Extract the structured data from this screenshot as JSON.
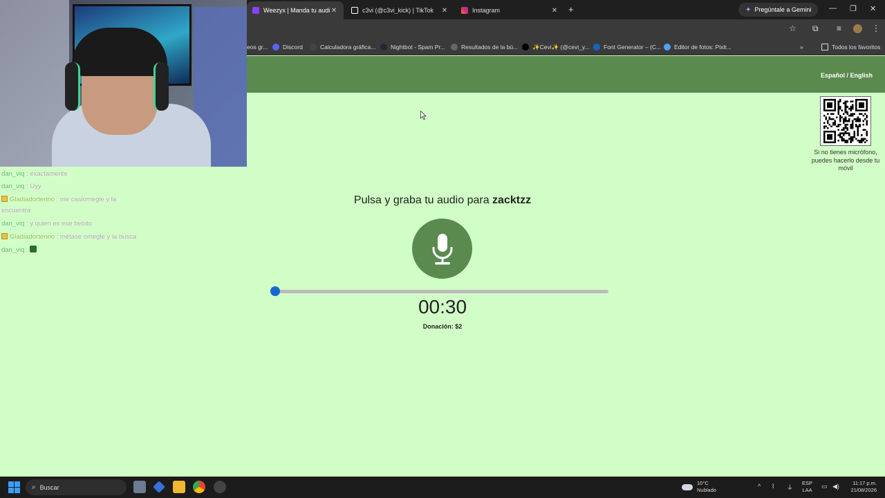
{
  "browser": {
    "tabs": [
      {
        "label": "Weezyx | Manda tu audio a zac",
        "active": true,
        "favicon_color": "#8a3ffc"
      },
      {
        "label": "c3vi (@c3vi_kick) | TikTok",
        "active": false,
        "favicon_color": "#ffffff"
      },
      {
        "label": "Instagram",
        "active": false,
        "favicon_color": "#e1306c"
      }
    ],
    "new_tab": "+",
    "gemini_button": "Pregúntale a Gemini",
    "window_controls": {
      "minimize": "—",
      "maximize": "❐",
      "close": "✕"
    },
    "bookmarks": [
      {
        "label": "eos gr...",
        "icon_color": "#555"
      },
      {
        "label": "Discord",
        "icon_color": "#5865f2"
      },
      {
        "label": "Calculadora gráfica...",
        "icon_color": "#444"
      },
      {
        "label": "Nightbot - Spam Pr...",
        "icon_color": "#1e2a38"
      },
      {
        "label": "Resultados de la bú...",
        "icon_color": "#666"
      },
      {
        "label": "✨Cevi✨ (@cevi_y...",
        "icon_color": "#000"
      },
      {
        "label": "Font Generator – (C...",
        "icon_color": "#1565c0"
      },
      {
        "label": "Editor de fotos: Pixlr...",
        "icon_color": "#4fa3ff"
      }
    ],
    "bookmarks_overflow": "»",
    "all_bookmarks": "Todos los favoritos"
  },
  "page": {
    "header_color": "#5a8a4e",
    "background_color": "#d1fec6",
    "language_toggle": "Español / English",
    "qr_caption": "Si no tienes micrófono, puedes hacerlo desde tu móvil",
    "prompt_text": "Pulsa y graba tu audio para ",
    "recipient": "zacktzz",
    "timer": "00:30",
    "donation": "Donación: $2",
    "progress_fraction": 0.0,
    "accent_color": "#1a66d2"
  },
  "stream_overlay": {
    "chat": [
      {
        "user": "dan_viq",
        "message": "exactamente",
        "badge": false
      },
      {
        "user": "dan_viq",
        "message": "Uyy",
        "badge": false
      },
      {
        "user": "Gladiadorterino",
        "message": "me casiomegle y la encuentra",
        "badge": true
      },
      {
        "user": "dan_viq",
        "message": "y quien es ese bebito",
        "badge": false
      },
      {
        "user": "Gladiadorterino",
        "message": "métase omegle y la busca",
        "badge": true
      },
      {
        "user": "dan_viq",
        "message": "",
        "badge": false,
        "emote": true
      }
    ]
  },
  "taskbar": {
    "search_placeholder": "Buscar",
    "weather_temp": "10°C",
    "weather_desc": "Nublado",
    "lang_top": "ESP",
    "lang_bottom": "LAA",
    "time": "11:17 p.m.",
    "date": "21/08/2026"
  }
}
